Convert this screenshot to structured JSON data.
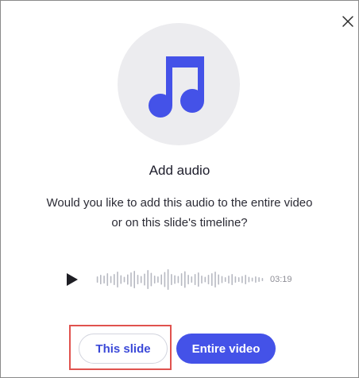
{
  "dialog": {
    "close_icon": "close-icon",
    "art_icon": "music-note-icon",
    "colors": {
      "accent": "#4452e8",
      "art_background": "#ececef",
      "highlight": "#e0524e"
    },
    "title": "Add audio",
    "description_lines": [
      "Would you like to add this audio to the entire video",
      "or on this slide's timeline?"
    ],
    "player": {
      "play_icon": "play-icon",
      "waveform_icon": "waveform-icon",
      "duration": "03:19"
    },
    "buttons": {
      "this_slide": "This slide",
      "entire_video": "Entire video"
    }
  }
}
